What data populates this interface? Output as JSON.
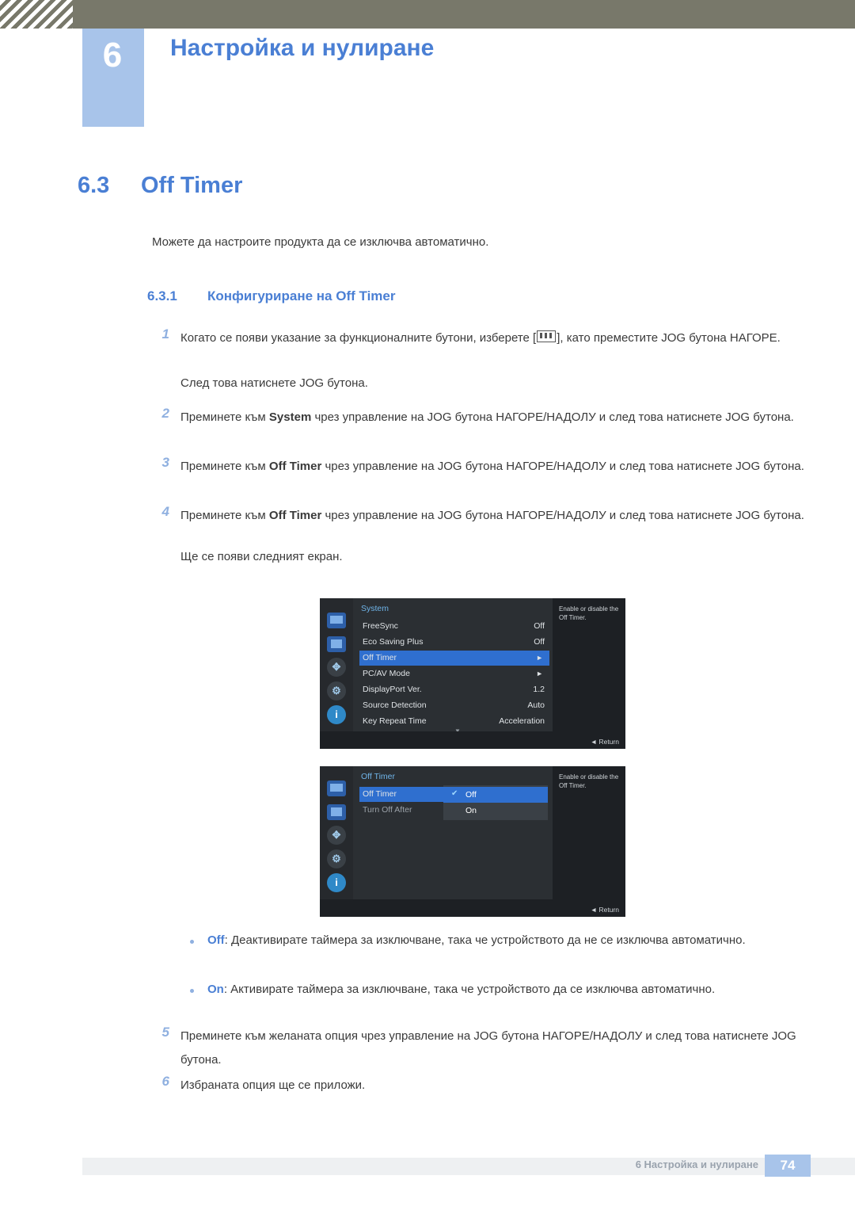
{
  "header": {
    "chapter_number": "6",
    "chapter_title": "Настройка и нулиране"
  },
  "section": {
    "number": "6.3",
    "title": "Off Timer",
    "intro": "Можете да настроите продукта да се изключва автоматично.",
    "subsection_number": "6.3.1",
    "subsection_title": "Конфигуриране на Off Timer"
  },
  "steps": [
    {
      "no": "1",
      "text_before": "Когато се появи указание за функционалните бутони, изберете [",
      "text_after": "], като преместите JOG бутона НАГОРЕ.",
      "extra": "След това натиснете JOG бутона."
    },
    {
      "no": "2",
      "pre": "Преминете към ",
      "strong": "System",
      "post": " чрез управление на JOG бутона НАГОРЕ/НАДОЛУ и след това натиснете JOG бутона."
    },
    {
      "no": "3",
      "pre": "Преминете към ",
      "strong": "Off Timer",
      "post": " чрез управление на JOG бутона НАГОРЕ/НАДОЛУ и след това натиснете JOG бутона."
    },
    {
      "no": "4",
      "pre": "Преминете към ",
      "strong": "Off Timer",
      "post": " чрез управление на JOG бутона НАГОРЕ/НАДОЛУ и след това натиснете JOG бутона.",
      "extra": "Ще се появи следният екран."
    },
    {
      "no": "5",
      "text": "Преминете към желаната опция чрез управление на JOG бутона НАГОРЕ/НАДОЛУ и след това натиснете JOG бутона."
    },
    {
      "no": "6",
      "text": "Избраната опция ще се приложи."
    }
  ],
  "osd_first": {
    "title": "System",
    "rows": [
      {
        "label": "FreeSync",
        "value": "Off"
      },
      {
        "label": "Eco Saving Plus",
        "value": "Off"
      },
      {
        "label": "Off Timer",
        "value": "",
        "arrow": "►",
        "highlight": true
      },
      {
        "label": "PC/AV Mode",
        "value": "",
        "arrow": "►"
      },
      {
        "label": "DisplayPort Ver.",
        "value": "1.2"
      },
      {
        "label": "Source Detection",
        "value": "Auto"
      },
      {
        "label": "Key Repeat Time",
        "value": "Acceleration"
      }
    ],
    "scroll": "▼",
    "help": "Enable or disable the Off Timer.",
    "return": "◄  Return"
  },
  "osd_second": {
    "title": "Off Timer",
    "rows": [
      {
        "label": "Off Timer",
        "highlight": true
      },
      {
        "label": "Turn Off After"
      }
    ],
    "popup": [
      {
        "label": "Off",
        "checked": true
      },
      {
        "label": "On",
        "checked": false
      }
    ],
    "help": "Enable or disable the Off Timer.",
    "return": "◄  Return"
  },
  "bullets": [
    {
      "term": "Off",
      "text": ": Деактивирате таймера за изключване, така че устройството да не се изключва автоматично."
    },
    {
      "term": "On",
      "text": ": Активирате таймера за изключване, така че устройството да се изключва автоматично."
    }
  ],
  "footer": {
    "text": "6 Настройка и нулиране",
    "page": "74"
  },
  "colors": {
    "accent_blue": "#4a7fd4",
    "badge_blue": "#a8c4ea",
    "header_olive": "#78786a"
  }
}
